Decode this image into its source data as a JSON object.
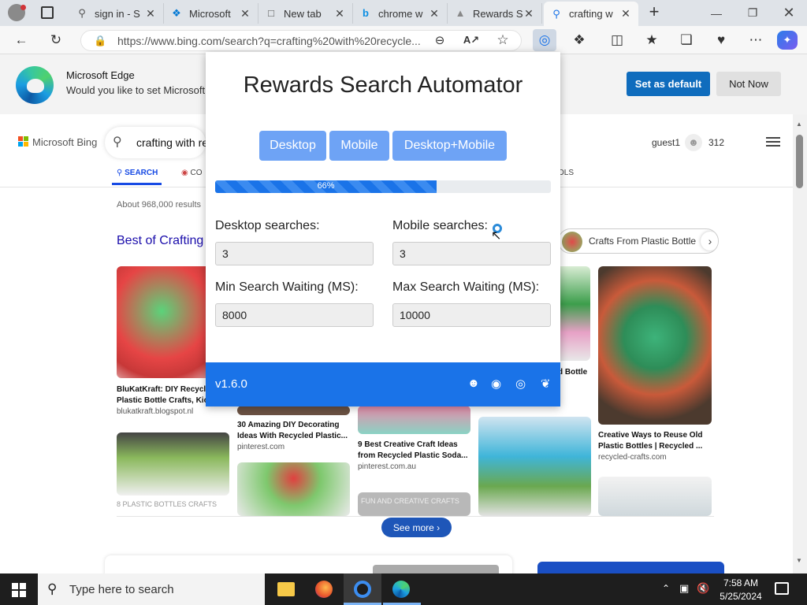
{
  "browser": {
    "tabs": [
      {
        "label": "sign in - S",
        "icon": "search-icon"
      },
      {
        "label": "Microsoft",
        "icon": "microsoft-icon"
      },
      {
        "label": "New tab",
        "icon": "page-icon"
      },
      {
        "label": "chrome w",
        "icon": "bing-icon"
      },
      {
        "label": "Rewards S",
        "icon": "rewards-icon"
      },
      {
        "label": "crafting w",
        "icon": "search-icon"
      }
    ],
    "url": "https://www.bing.com/search?q=crafting%20with%20recycle..."
  },
  "edge_prompt": {
    "title": "Microsoft Edge",
    "message": "Would you like to set Microsoft E",
    "default_button": "Set as default",
    "not_now_button": "Not Now"
  },
  "bing": {
    "logo": "Microsoft Bing",
    "query": "crafting with re",
    "user": "guest1",
    "points": "312",
    "tab_search": "SEARCH",
    "tab_copilot": "CO",
    "tab_tools": "OLS",
    "results_count": "About 968,000 results",
    "section_title": "Best of Crafting",
    "chip_label": "Crafts From Plastic Bottle",
    "cards": [
      {
        "title": "BluKatKraft: DIY Recycle",
        "title2": "Plastic Bottle Crafts, Kic",
        "source": "blukatkraft.blogspot.nl"
      },
      {
        "title": "30 Amazing DIY Decorating",
        "title2": "Ideas With Recycled Plastic...",
        "source": "pinterest.com"
      },
      {
        "title": "9 Best Creative Craft Ideas",
        "title2": "from Recycled Plastic Soda...",
        "source": "pinterest.com.au"
      },
      {
        "title": "Creative Ways to Reuse Old",
        "title2": "Plastic Bottles | Recycled ...",
        "source": "recycled-crafts.com"
      }
    ],
    "partial_card_text": "d Bottle",
    "thumb_caption_1": "8 PLASTIC BOTTLES CRAFTS",
    "thumb_caption_2": "FUN AND CREATIVE CRAFTS",
    "see_more": "See more"
  },
  "extension": {
    "title": "Rewards Search Automator",
    "modes": [
      "Desktop",
      "Mobile",
      "Desktop+Mobile"
    ],
    "progress_label": "66%",
    "progress_value": 0.66,
    "desktop_label": "Desktop searches:",
    "desktop_value": "3",
    "mobile_label": "Mobile searches:",
    "mobile_value": "3",
    "min_label": "Min Search Waiting (MS):",
    "min_value": "8000",
    "max_label": "Max Search Waiting (MS):",
    "max_value": "10000",
    "version": "v1.6.0"
  },
  "taskbar": {
    "search_placeholder": "Type here to search",
    "time": "7:58 AM",
    "date": "5/25/2024"
  },
  "colors": {
    "accent": "#1a73e8",
    "mode_button": "#6ea3f5",
    "edge_blue": "#0f6cbd"
  }
}
